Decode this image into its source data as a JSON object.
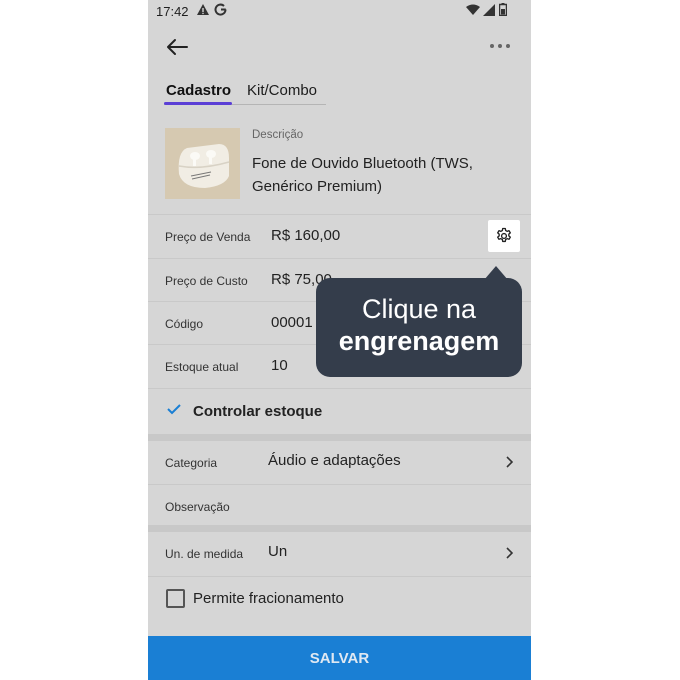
{
  "status_bar": {
    "time": "17:42",
    "left_icons": [
      "warning-icon",
      "google-icon"
    ],
    "right_icons": [
      "wifi-icon",
      "signal-icon",
      "battery-icon"
    ]
  },
  "tabs": [
    {
      "label": "Cadastro",
      "active": true
    },
    {
      "label": "Kit/Combo",
      "active": false
    }
  ],
  "product": {
    "description_label": "Descrição",
    "description_value": "Fone de Ouvido Bluetooth (TWS, Genérico Premium)"
  },
  "fields": {
    "sale_price": {
      "label": "Preço de Venda",
      "value": "R$ 160,00"
    },
    "cost_price": {
      "label": "Preço de Custo",
      "value": "R$ 75,00"
    },
    "code": {
      "label": "Código",
      "value": "00001"
    },
    "stock": {
      "label": "Estoque atual",
      "value": "10"
    },
    "control_stock": {
      "label": "Controlar estoque",
      "checked": true
    },
    "category": {
      "label": "Categoria",
      "value": "Áudio e adaptações"
    },
    "notes": {
      "label": "Observação",
      "value": ""
    },
    "unit": {
      "label": "Un. de medida",
      "value": "Un"
    },
    "fractional": {
      "label": "Permite fracionamento",
      "checked": false
    }
  },
  "save_label": "SALVAR",
  "tooltip": {
    "line1": "Clique na",
    "line2": "engrenagem"
  },
  "colors": {
    "accent": "#1a7fd4",
    "tab_indicator": "#5b3fd6",
    "tooltip_bg": "#343d4b",
    "screen_bg": "#d6d6d6",
    "check": "#1a7fd4"
  }
}
